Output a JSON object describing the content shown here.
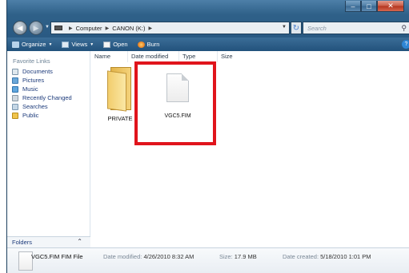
{
  "address": {
    "segments": [
      "Computer",
      "CANON (K:)"
    ],
    "search_placeholder": "Search"
  },
  "toolbar": {
    "organize": "Organize",
    "views": "Views",
    "open": "Open",
    "burn": "Burn"
  },
  "nav_pane": {
    "header": "Favorite Links",
    "items": [
      "Documents",
      "Pictures",
      "Music",
      "Recently Changed",
      "Searches",
      "Public"
    ],
    "folders_label": "Folders"
  },
  "columns": [
    "Name",
    "Date modified",
    "Type",
    "Size"
  ],
  "files": [
    {
      "name": "PRIVATE",
      "kind": "folder"
    },
    {
      "name": "VGC5.FIM",
      "kind": "file"
    }
  ],
  "details": {
    "name": "VGC5.FIM",
    "type": "FIM File",
    "modified_label": "Date modified:",
    "modified_value": "4/26/2010 8:32 AM",
    "size_label": "Size:",
    "size_value": "17.9 MB",
    "created_label": "Date created:",
    "created_value": "5/18/2010 1:01 PM"
  },
  "colors": {
    "highlight": "#e0141c",
    "window_frame": "#2a5a83",
    "link_text": "#1c3a7a"
  }
}
